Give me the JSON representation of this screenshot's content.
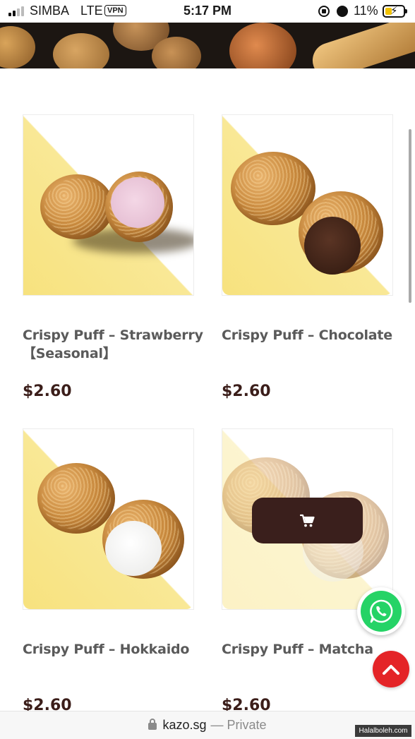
{
  "status_bar": {
    "carrier": "SIMBA",
    "network": "LTE",
    "vpn": "VPN",
    "time": "5:17 PM",
    "battery": "11%"
  },
  "products": [
    {
      "name": "Crispy Puff – Strawberry 【Seasonal】",
      "price": "$2.60"
    },
    {
      "name": "Crispy Puff – Chocolate",
      "price": "$2.60"
    },
    {
      "name": "Crispy Puff – Hokkaido",
      "price": "$2.60"
    },
    {
      "name": "Crispy Puff – Matcha",
      "price": "$2.60"
    }
  ],
  "cart_button": {
    "icon": "cart-icon"
  },
  "floating": {
    "whatsapp_icon": "whatsapp-icon",
    "scroll_top_icon": "chevron-up-icon"
  },
  "url_bar": {
    "domain": "kazo.sg",
    "mode": "— Private"
  },
  "watermark": "Halalboleh.com",
  "colors": {
    "price": "#3b1e1a",
    "cart_button": "#3a1f1c",
    "scroll_top": "#e42427",
    "whatsapp": "#25d366",
    "card_yellow": "#f7e27e"
  }
}
